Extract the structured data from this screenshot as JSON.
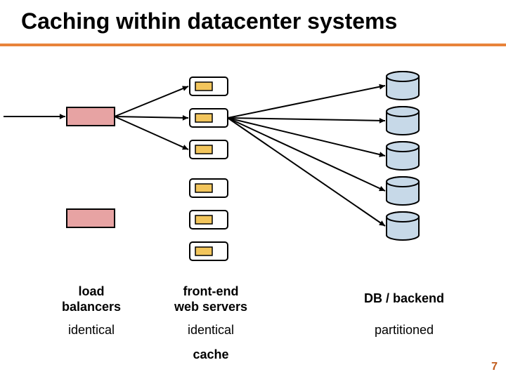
{
  "title": "Caching within datacenter systems",
  "page_number": "7",
  "columns": {
    "load_balancers": {
      "label": "load\nbalancers",
      "sub": "identical"
    },
    "web_servers": {
      "label": "front-end\nweb servers",
      "sub": "identical",
      "extra": "cache"
    },
    "backend": {
      "label": "DB / backend",
      "sub": "partitioned"
    }
  },
  "colors": {
    "lb_fill": "#e7a3a3",
    "server_body": "#ffffff",
    "server_cache": "#f2c55c",
    "db_fill": "#c7d9e8",
    "stroke": "#000000"
  }
}
